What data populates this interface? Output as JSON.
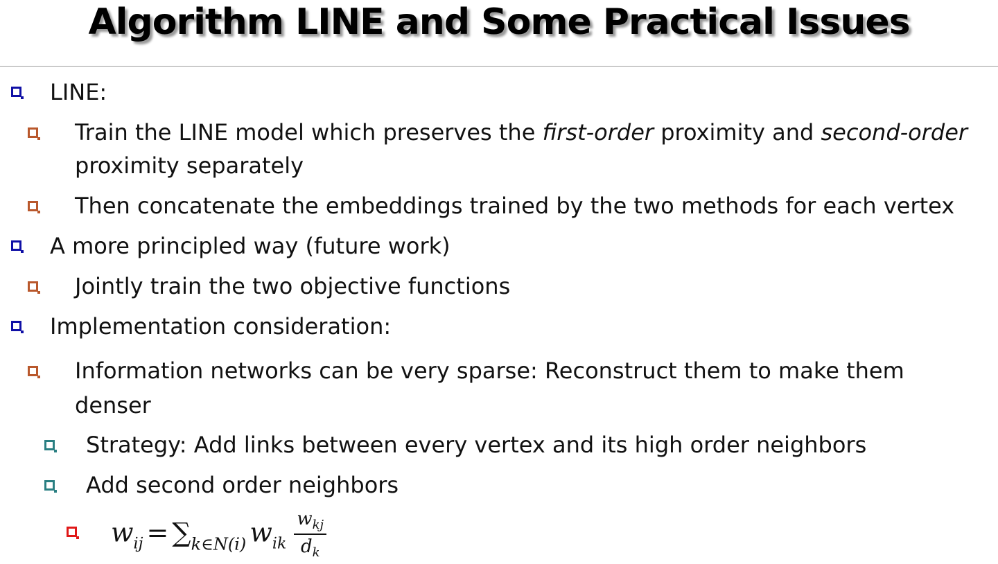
{
  "title": "Algorithm LINE and Some Practical Issues",
  "items": {
    "line_label": "LINE:",
    "train_text_a": "Train the LINE model which preserves the ",
    "train_first_order": "first-order",
    "train_text_b": " proximity and ",
    "train_second_order": "second-order",
    "train_text_c": "proximity separately",
    "concat": "Then concatenate the embeddings trained by the two methods for each vertex",
    "principled": "A more principled way (future work)",
    "jointly": "Jointly train the two objective functions",
    "implementation": "Implementation consideration:",
    "sparse_a": "Information networks can be very sparse: Reconstruct them to make them",
    "sparse_b": "denser",
    "strategy": "Strategy: Add links between every vertex and its high order neighbors",
    "second_neighbors": "Add second order neighbors"
  },
  "formula": {
    "lhs": "w",
    "lhs_sub": "ij",
    "equals": "=",
    "sum": "∑",
    "sum_sub": "k∈N(i)",
    "w": "w",
    "w_sub": "ik",
    "num": "w",
    "num_sub": "kj",
    "den": "d",
    "den_sub": "k"
  },
  "colors": {
    "level1_bullet": "#1010a6",
    "level2_bullet": "#b9582c",
    "level3_bullet": "#2a7f82",
    "level4_bullet": "#e01818"
  }
}
